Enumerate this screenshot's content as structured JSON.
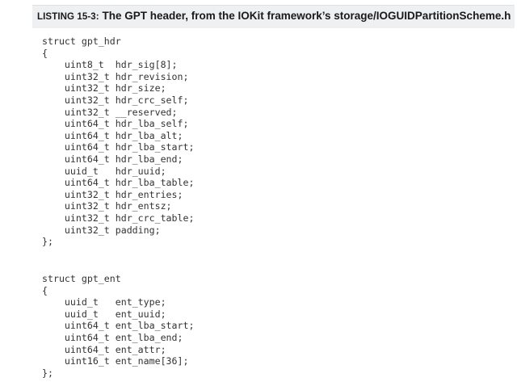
{
  "listing": {
    "label": "LISTING 15-3:",
    "caption": "The GPT header, from the IOKit framework’s storage/IOGUIDPartitionScheme.h"
  },
  "code_blocks": [
    {
      "lines": [
        "struct gpt_hdr",
        "{",
        "    uint8_t  hdr_sig[8];",
        "    uint32_t hdr_revision;",
        "    uint32_t hdr_size;",
        "    uint32_t hdr_crc_self;",
        "    uint32_t __reserved;",
        "    uint64_t hdr_lba_self;",
        "    uint64_t hdr_lba_alt;",
        "    uint64_t hdr_lba_start;",
        "    uint64_t hdr_lba_end;",
        "    uuid_t   hdr_uuid;",
        "    uint64_t hdr_lba_table;",
        "    uint32_t hdr_entries;",
        "    uint32_t hdr_entsz;",
        "    uint32_t hdr_crc_table;",
        "    uint32_t padding;",
        "};"
      ]
    },
    {
      "lines": [
        "struct gpt_ent",
        "{",
        "    uuid_t   ent_type;",
        "    uuid_t   ent_uuid;",
        "    uint64_t ent_lba_start;",
        "    uint64_t ent_lba_end;",
        "    uint64_t ent_attr;",
        "    uint16_t ent_name[36];",
        "};"
      ]
    }
  ]
}
